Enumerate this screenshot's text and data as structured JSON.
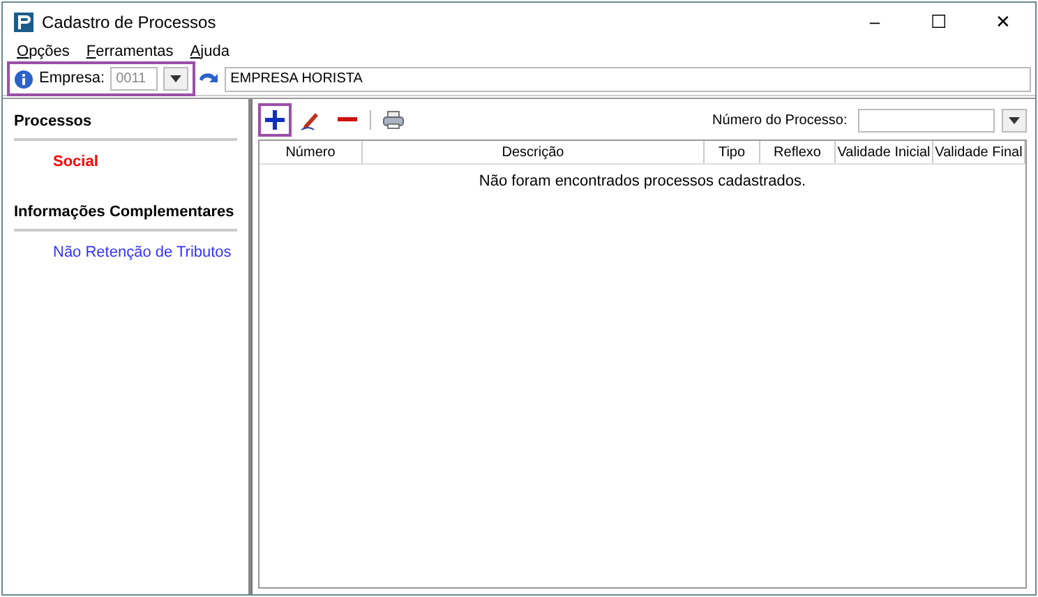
{
  "window": {
    "title": "Cadastro de Processos",
    "controls": [
      "–",
      "☐",
      "✕"
    ]
  },
  "menu": [
    "Opções",
    "Ferramentas",
    "Ajuda"
  ],
  "company_bar": {
    "label": "Empresa:",
    "code": "0011",
    "name": "EMPRESA HORISTA",
    "highlighted": true
  },
  "sidebar": [
    {
      "heading": "Processos",
      "items": [
        {
          "label": "Social",
          "selected": true
        }
      ]
    },
    {
      "heading": "Informações Complementares",
      "items": [
        {
          "label": "Não Retenção de Tributos",
          "selected": false
        }
      ]
    }
  ],
  "toolbar": {
    "tools": [
      {
        "kind": "add",
        "highlighted": true
      },
      {
        "kind": "edit",
        "highlighted": false
      },
      {
        "kind": "remove",
        "highlighted": false
      },
      {
        "kind": "print",
        "highlighted": false
      }
    ],
    "search_label": "Número do Processo:"
  },
  "table": {
    "columns": [
      "Número",
      "Descrição",
      "Tipo",
      "Reflexo",
      "Validade Inicial",
      "Validade Final"
    ],
    "empty_message": "Não foram encontrados processos cadastrados."
  }
}
